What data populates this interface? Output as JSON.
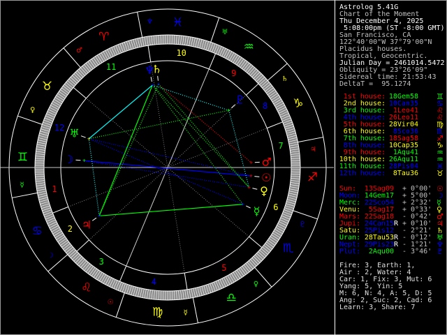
{
  "header": [
    {
      "text": "Astrolog 5.41G",
      "color": "#ffffff"
    },
    {
      "text": "Chart of the Moment",
      "color": "#c0c0c0"
    },
    {
      "text": "Thu December 4, 2025",
      "color": "#ffffff"
    },
    {
      "text": " 5:08:00pm (ST -8:00 GMT)",
      "color": "#ffffff"
    },
    {
      "text": "San Francisco, CA",
      "color": "#c0c0c0"
    },
    {
      "text": "122°40'00\"W 37°79'00\"N",
      "color": "#c0c0c0"
    },
    {
      "text": "Placidus houses.",
      "color": "#c0c0c0"
    },
    {
      "text": "Tropical, Geocentric.",
      "color": "#c0c0c0"
    },
    {
      "text": "Julian Day = 2461014.5472",
      "color": "#ffffff"
    },
    {
      "text": "Obliquity = 23°26'09\"",
      "color": "#c0c0c0"
    },
    {
      "text": "Sidereal time: 21:53:43",
      "color": "#c0c0c0"
    },
    {
      "text": "DeltaT =  95.1274",
      "color": "#c0c0c0"
    }
  ],
  "colors": {
    "fire": "#ff0000",
    "earth": "#ffff00",
    "air": "#00ff00",
    "water": "#0000ff",
    "text": "#c0c0c0",
    "ring": "#ffffff"
  },
  "signs": [
    {
      "key": "aries",
      "glyph": "♈",
      "ruler": "♂"
    },
    {
      "key": "taurus",
      "glyph": "♉",
      "ruler": "♀"
    },
    {
      "key": "gemini",
      "glyph": "♊",
      "ruler": "☿"
    },
    {
      "key": "cancer",
      "glyph": "♋",
      "ruler": "☽"
    },
    {
      "key": "leo",
      "glyph": "♌",
      "ruler": "☉"
    },
    {
      "key": "virgo",
      "glyph": "♍",
      "ruler": "☿"
    },
    {
      "key": "libra",
      "glyph": "♎",
      "ruler": "♀"
    },
    {
      "key": "scorpio",
      "glyph": "♏",
      "ruler": "♇"
    },
    {
      "key": "sagittarius",
      "glyph": "♐",
      "ruler": "♃"
    },
    {
      "key": "capricorn",
      "glyph": "♑",
      "ruler": "♄"
    },
    {
      "key": "aquarius",
      "glyph": "♒",
      "ruler": "♅"
    },
    {
      "key": "pisces",
      "glyph": "♓",
      "ruler": "♆"
    }
  ],
  "houses": [
    {
      "label": "1st house:",
      "value": "18Gem58",
      "lon": 78.97
    },
    {
      "label": "2nd house:",
      "value": "10Can35",
      "lon": 100.58
    },
    {
      "label": "3rd house:",
      "value": "1Leo41",
      "lon": 121.68
    },
    {
      "label": "4th house:",
      "value": "26Leo11",
      "lon": 146.18
    },
    {
      "label": "5th house:",
      "value": "28Vir04",
      "lon": 178.07
    },
    {
      "label": "6th house:",
      "value": "8Sco36",
      "lon": 218.6
    },
    {
      "label": "7th house:",
      "value": "18Sag58",
      "lon": 258.97
    },
    {
      "label": "8th house:",
      "value": "10Cap35",
      "lon": 280.58
    },
    {
      "label": "9th house:",
      "value": "1Aqu41",
      "lon": 301.68
    },
    {
      "label": "10th house:",
      "value": "26Aqu11",
      "lon": 326.18
    },
    {
      "label": "11th house:",
      "value": "28Pis04",
      "lon": 358.07
    },
    {
      "label": "12th house:",
      "value": "8Tau36",
      "lon": 38.6
    }
  ],
  "planets": [
    {
      "key": "sun",
      "name": "Sun:",
      "glyph": "☉",
      "color": "#ff0000",
      "value": "13Sag09",
      "retro": "",
      "lat": "+ 0°00'",
      "lon": 253.15
    },
    {
      "key": "moon",
      "name": "Moon:",
      "glyph": "☽",
      "color": "#0000ff",
      "value": "14Gem17",
      "retro": "",
      "lat": "+ 5°00'",
      "lon": 74.28
    },
    {
      "key": "mercury",
      "name": "Merc:",
      "glyph": "☿",
      "color": "#00ff00",
      "value": "22Sco54",
      "retro": "",
      "lat": "+ 2°32'",
      "lon": 232.9
    },
    {
      "key": "venus",
      "name": "Venu:",
      "glyph": "♀",
      "color": "#ffff00",
      "value": "5Sag17",
      "retro": "",
      "lat": "+ 0°33'",
      "lon": 245.28
    },
    {
      "key": "mars",
      "name": "Mars:",
      "glyph": "♂",
      "color": "#ff0000",
      "value": "22Sag18",
      "retro": "",
      "lat": "- 0°42'",
      "lon": 262.3
    },
    {
      "key": "jupiter",
      "name": "Jupi:",
      "glyph": "♃",
      "color": "#ff0000",
      "value": "24Can15",
      "retro": "R",
      "lat": "+ 0°10'",
      "lon": 114.25
    },
    {
      "key": "saturn",
      "name": "Satu:",
      "glyph": "♄",
      "color": "#ffff00",
      "value": "25Pis12",
      "retro": "",
      "lat": "- 2°21'",
      "lon": 355.2
    },
    {
      "key": "uranus",
      "name": "Uran:",
      "glyph": "♅",
      "color": "#00ff00",
      "value": "28Tau53",
      "retro": "R",
      "lat": "- 0°12'",
      "lon": 58.88
    },
    {
      "key": "neptune",
      "name": "Nept:",
      "glyph": "♆",
      "color": "#0000ff",
      "value": "29Pis23",
      "retro": "R",
      "lat": "- 1°21'",
      "lon": 359.38
    },
    {
      "key": "pluto",
      "name": "Plut:",
      "glyph": "♇",
      "color": "#0000ff",
      "value": "2Aqu00",
      "retro": "",
      "lat": "- 3°46'",
      "lon": 302.0
    }
  ],
  "aspects": [
    {
      "a": "moon",
      "b": "sun",
      "color": "#0000ff",
      "style": "solid"
    },
    {
      "a": "jupiter",
      "b": "mercury",
      "color": "#00ff00",
      "style": "solid"
    },
    {
      "a": "jupiter",
      "b": "neptune",
      "color": "#00ff00",
      "style": "solid"
    },
    {
      "a": "uranus",
      "b": "neptune",
      "color": "#00ffff",
      "style": "solid"
    },
    {
      "a": "neptune",
      "b": "pluto",
      "color": "#00ffff",
      "style": "dotted"
    },
    {
      "a": "uranus",
      "b": "pluto",
      "color": "#00ff00",
      "style": "dotted"
    },
    {
      "a": "jupiter",
      "b": "uranus",
      "color": "#00ffff",
      "style": "dotted"
    },
    {
      "a": "saturn",
      "b": "mars",
      "color": "#ff0000",
      "style": "dotted"
    },
    {
      "a": "saturn",
      "b": "venus",
      "color": "#00ff00",
      "style": "dotted"
    },
    {
      "a": "neptune",
      "b": "venus",
      "color": "#00ff00",
      "style": "dotted"
    },
    {
      "a": "neptune",
      "b": "mercury",
      "color": "#00ff00",
      "style": "dotted"
    },
    {
      "a": "saturn",
      "b": "jupiter",
      "color": "#00ff00",
      "style": "dotted"
    },
    {
      "a": "moon",
      "b": "venus",
      "color": "#0000ff",
      "style": "dotted"
    },
    {
      "a": "uranus",
      "b": "mercury",
      "color": "#0000ff",
      "style": "dotted"
    },
    {
      "a": "uranus",
      "b": "sun",
      "color": "#0000ff",
      "style": "dotted"
    },
    {
      "a": "pluto",
      "b": "venus",
      "color": "#00ffff",
      "style": "dotted"
    }
  ],
  "summary": [
    "Fire: 3, Earth: 1,",
    "Air : 2, Water: 4",
    "Car: 1, Fix: 3, Mut: 6",
    "Yang: 5, Yin: 5",
    "M: 6, N: 4, A: 5, D: 5",
    "Ang: 2, Suc: 2, Cad: 6",
    "Learn: 3, Share: 7"
  ]
}
